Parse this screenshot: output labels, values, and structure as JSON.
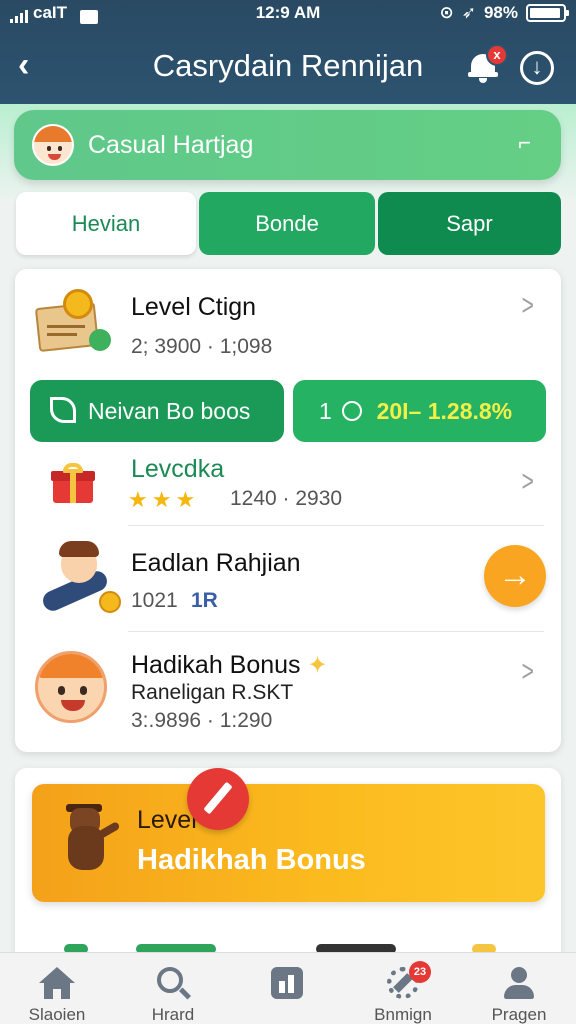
{
  "status_bar": {
    "carrier": "caIT",
    "time": "12:9 AM",
    "battery": "98%"
  },
  "header": {
    "back_icon": "chevron-left-icon",
    "title": "Casrydain Rennijan",
    "notification_badge": "x",
    "notification_icon": "bell-icon",
    "download_icon": "download-circle-icon"
  },
  "user_bar": {
    "name": "Casual Hartjag",
    "chevron": "⌐"
  },
  "tabs": [
    {
      "label": "Hevian",
      "active": true
    },
    {
      "label": "Bonde",
      "active": false
    },
    {
      "label": "Sapr",
      "active": false
    }
  ],
  "main_card": {
    "level_row": {
      "title": "Level Ctign",
      "subtitle": "2; 3900 · 1;098"
    },
    "buttons": {
      "left_label": "Neivan Bo boos",
      "right_prefix": "1",
      "right_value": "20I–  1.28.8%"
    },
    "rows": [
      {
        "title": "Levcdka",
        "subtitle": "1240 · 2930",
        "rating": 3
      },
      {
        "title": "Eadlan Rahjian",
        "subtitle": "1021",
        "tag": "1R"
      },
      {
        "title": "Hadikah Bonus",
        "subtitle": "Raneligan R.SKT",
        "detail": "3:.9896 · 1:290"
      }
    ]
  },
  "promo": {
    "line1": "Level",
    "line2": "Hadikhah Bonus"
  },
  "bottom_nav": [
    {
      "label": "Slaoien",
      "icon": "home-icon"
    },
    {
      "label": "Hrard",
      "icon": "search-icon"
    },
    {
      "label": "",
      "icon": "leaderboard-icon"
    },
    {
      "label": "Bnmign",
      "icon": "settings-icon",
      "badge": "23"
    },
    {
      "label": "Pragen",
      "icon": "profile-icon"
    }
  ],
  "colors": {
    "header_bg": "#2c5370",
    "accent_green": "#1a9a56",
    "orange": "#f9a521",
    "badge_red": "#e53935"
  }
}
